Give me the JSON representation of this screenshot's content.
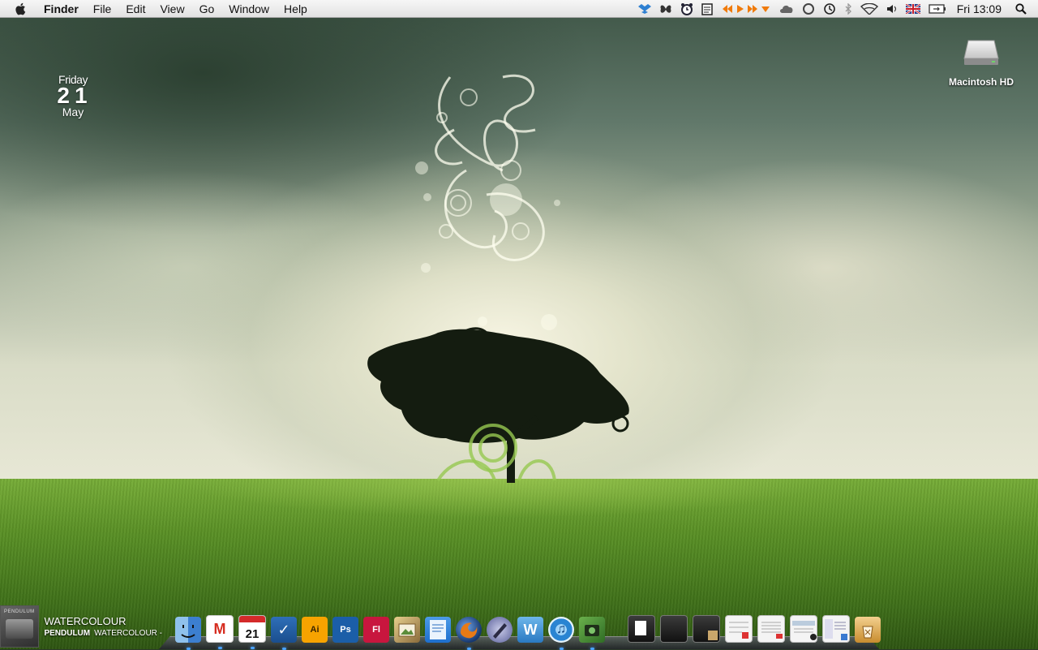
{
  "menubar": {
    "app_name": "Finder",
    "menus": [
      "File",
      "Edit",
      "View",
      "Go",
      "Window",
      "Help"
    ],
    "clock": "Fri 13:09",
    "status_icons": [
      "dropbox-icon",
      "butterfly-icon",
      "alarm-clock-icon",
      "notes-icon",
      "media-controls-icon",
      "cloud-icon",
      "sync-icon",
      "time-machine-icon",
      "bluetooth-icon",
      "wifi-icon",
      "volume-icon",
      "uk-flag-icon",
      "battery-icon",
      "spotlight-icon"
    ]
  },
  "date_widget": {
    "day": "Friday",
    "number": "21",
    "month": "May"
  },
  "desktop": {
    "hd_label": "Macintosh HD"
  },
  "now_playing": {
    "title": "WATERCOLOUR",
    "artist": "PENDULUM",
    "track": "WATERCOLOUR - ",
    "art_text": "PENDULUM"
  },
  "dock": {
    "apps": [
      {
        "name": "Finder",
        "icon": "finder-icon",
        "glyph": "",
        "running": true
      },
      {
        "name": "Gmail",
        "icon": "gmail-icon",
        "glyph": "M",
        "running": true
      },
      {
        "name": "iCal",
        "icon": "ical-icon",
        "glyph": "21",
        "running": true
      },
      {
        "name": "To Do",
        "icon": "todo-icon",
        "glyph": "✓",
        "running": true
      },
      {
        "name": "Illustrator",
        "icon": "illustrator-icon",
        "glyph": "Ai",
        "running": false
      },
      {
        "name": "Photoshop",
        "icon": "photoshop-icon",
        "glyph": "Ps",
        "running": false
      },
      {
        "name": "Flash",
        "icon": "flash-icon",
        "glyph": "Fl",
        "running": false
      },
      {
        "name": "iPhoto",
        "icon": "iphoto-icon",
        "glyph": "",
        "running": false
      },
      {
        "name": "TextEdit",
        "icon": "textedit-icon",
        "glyph": "",
        "running": false
      },
      {
        "name": "Firefox",
        "icon": "firefox-icon",
        "glyph": "",
        "running": true
      },
      {
        "name": "Script Editor",
        "icon": "script-editor-icon",
        "glyph": "",
        "running": false
      },
      {
        "name": "Word",
        "icon": "word-icon",
        "glyph": "W",
        "running": false
      },
      {
        "name": "iTunes",
        "icon": "itunes-icon",
        "glyph": "♫",
        "running": true
      },
      {
        "name": "Image Capture",
        "icon": "image-capture-icon",
        "glyph": "",
        "running": true
      }
    ],
    "docs": [
      {
        "icon": "folder-icon"
      },
      {
        "icon": "folder-icon"
      },
      {
        "icon": "folder-icon"
      },
      {
        "icon": "document-icon"
      },
      {
        "icon": "document-icon"
      },
      {
        "icon": "document-icon"
      },
      {
        "icon": "document-icon"
      },
      {
        "icon": "trash-icon"
      }
    ]
  }
}
